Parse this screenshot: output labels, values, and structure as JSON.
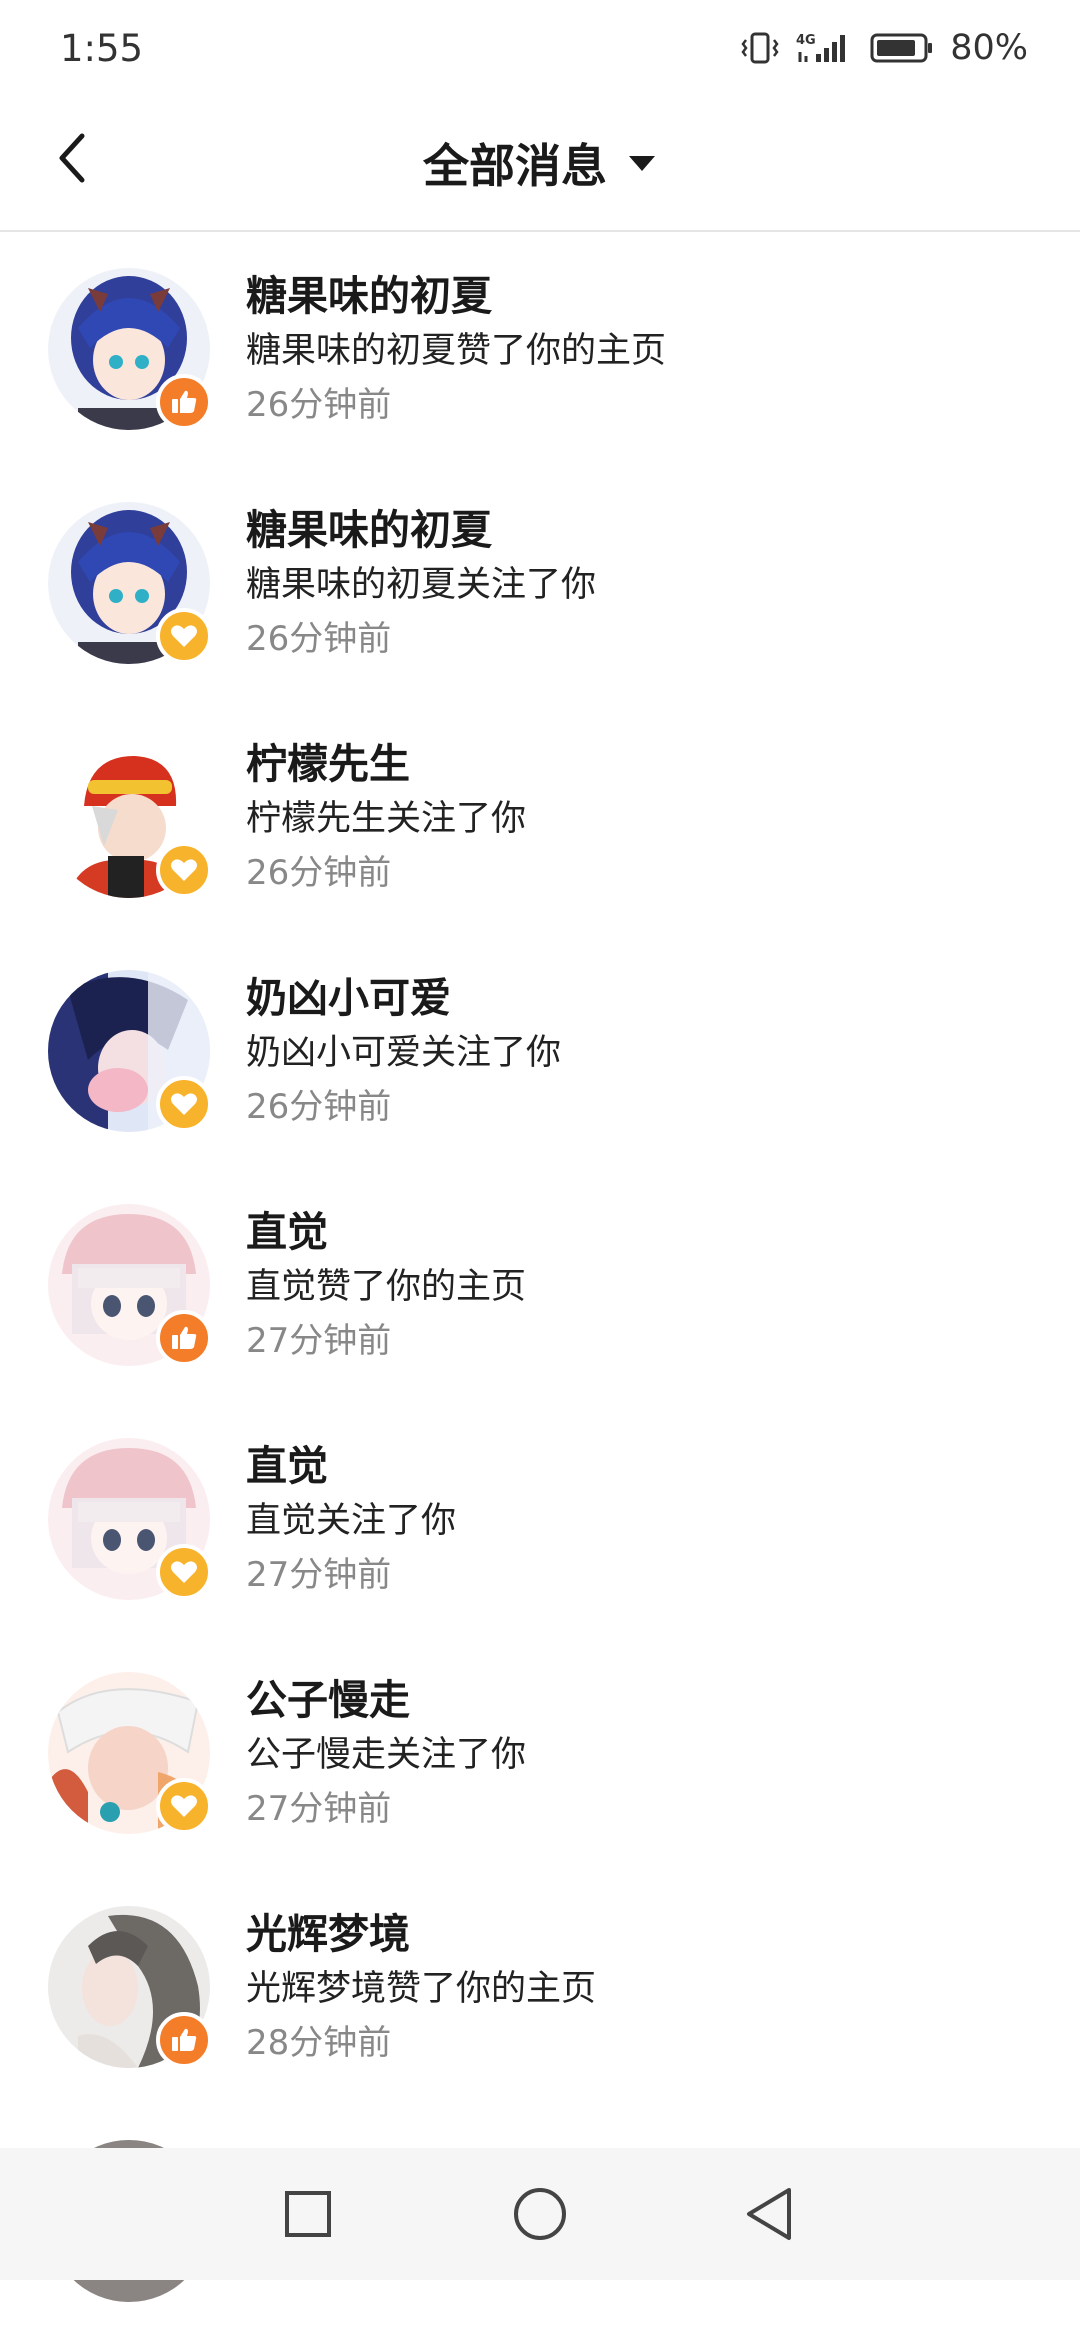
{
  "status_bar": {
    "time": "1:55",
    "battery": "80%",
    "network": "4G"
  },
  "header": {
    "title": "全部消息"
  },
  "colors": {
    "like_badge": "#f47d2a",
    "follow_badge": "#f8b32c",
    "time_text": "#888888"
  },
  "messages": [
    {
      "name": "糖果味的初夏",
      "text": "糖果味的初夏赞了你的主页",
      "time": "26分钟前",
      "type": "like",
      "avatar_icon": "anime-avatar-blue-hair-icon"
    },
    {
      "name": "糖果味的初夏",
      "text": "糖果味的初夏关注了你",
      "time": "26分钟前",
      "type": "follow",
      "avatar_icon": "anime-avatar-blue-hair-icon"
    },
    {
      "name": "柠檬先生",
      "text": "柠檬先生关注了你",
      "time": "26分钟前",
      "type": "follow",
      "avatar_icon": "anime-avatar-red-helmet-icon"
    },
    {
      "name": "奶凶小可爱",
      "text": "奶凶小可爱关注了你",
      "time": "26分钟前",
      "type": "follow",
      "avatar_icon": "anime-avatar-dark-hair-icon"
    },
    {
      "name": "直觉",
      "text": "直觉赞了你的主页",
      "time": "27分钟前",
      "type": "like",
      "avatar_icon": "anime-avatar-white-hair-icon"
    },
    {
      "name": "直觉",
      "text": "直觉关注了你",
      "time": "27分钟前",
      "type": "follow",
      "avatar_icon": "anime-avatar-white-hair-icon"
    },
    {
      "name": "公子慢走",
      "text": "公子慢走关注了你",
      "time": "27分钟前",
      "type": "follow",
      "avatar_icon": "anime-avatar-pale-boy-icon"
    },
    {
      "name": "光辉梦境",
      "text": "光辉梦境赞了你的主页",
      "time": "28分钟前",
      "type": "like",
      "avatar_icon": "portrait-avatar-girl-icon"
    }
  ],
  "nav_bar": {
    "buttons": [
      "recents-square-icon",
      "home-circle-icon",
      "back-triangle-icon"
    ]
  }
}
